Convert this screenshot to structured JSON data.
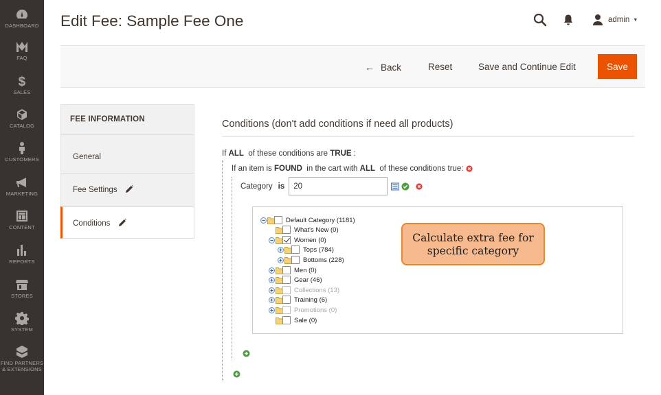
{
  "nav": [
    {
      "label": "DASHBOARD",
      "icon": "dashboard-icon"
    },
    {
      "label": "FAQ",
      "icon": "faq-icon"
    },
    {
      "label": "SALES",
      "icon": "dollar-icon"
    },
    {
      "label": "CATALOG",
      "icon": "cube-icon"
    },
    {
      "label": "CUSTOMERS",
      "icon": "person-icon"
    },
    {
      "label": "MARKETING",
      "icon": "megaphone-icon"
    },
    {
      "label": "CONTENT",
      "icon": "layout-icon"
    },
    {
      "label": "REPORTS",
      "icon": "bar-chart-icon"
    },
    {
      "label": "STORES",
      "icon": "store-icon"
    },
    {
      "label": "SYSTEM",
      "icon": "gear-icon"
    },
    {
      "label_line1": "FIND PARTNERS",
      "label_line2": "& EXTENSIONS",
      "icon": "box-icon"
    }
  ],
  "header": {
    "title": "Edit Fee: Sample Fee One",
    "user_name": "admin"
  },
  "actions": {
    "back": "Back",
    "reset": "Reset",
    "save_continue": "Save and Continue Edit",
    "save": "Save"
  },
  "tabs": {
    "heading": "FEE INFORMATION",
    "items": [
      {
        "label": "General"
      },
      {
        "label": "Fee Settings"
      },
      {
        "label": "Conditions"
      }
    ]
  },
  "conditions": {
    "title": "Conditions (don't add conditions if need all products)",
    "line1": {
      "pre": "If",
      "agg": "ALL",
      "mid": "of these conditions are",
      "val": "TRUE",
      "post": ":"
    },
    "line2": {
      "pre": "If an item is",
      "found": "FOUND",
      "mid": "in the cart with",
      "agg": "ALL",
      "post": "of these conditions true:"
    },
    "category": {
      "label": "Category",
      "operator": "is",
      "value": "20"
    }
  },
  "tree": [
    {
      "label": "Default Category (1181)"
    },
    {
      "label": "What's New (0)"
    },
    {
      "label": "Women (0)"
    },
    {
      "label": "Tops (784)"
    },
    {
      "label": "Bottoms (228)"
    },
    {
      "label": "Men (0)"
    },
    {
      "label": "Gear (46)"
    },
    {
      "label": "Collections (13)"
    },
    {
      "label": "Training (6)"
    },
    {
      "label": "Promotions (0)"
    },
    {
      "label": "Sale (0)"
    }
  ],
  "callout": {
    "line1": "Calculate extra fee for",
    "line2": "specific category"
  },
  "colors": {
    "accent": "#eb5202",
    "sidebar": "#373330",
    "add_green": "#4f9a43",
    "remove_red": "#e2413b"
  }
}
